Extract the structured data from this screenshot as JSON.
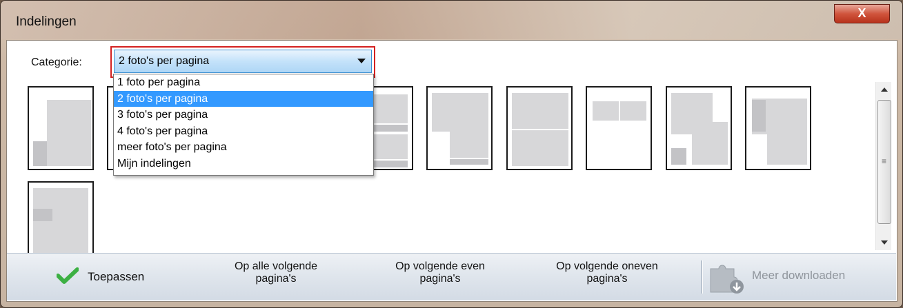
{
  "window": {
    "title": "Indelingen",
    "close_glyph": "X"
  },
  "category": {
    "label": "Categorie:",
    "selected": "2 foto's per pagina",
    "options": [
      "1 foto per pagina",
      "2 foto's per pagina",
      "3 foto's per pagina",
      "4 foto's per pagina",
      "meer foto's per pagina",
      "Mijn indelingen"
    ],
    "highlight_color": "#d32020"
  },
  "actions": {
    "apply": "Toepassen",
    "all_following": [
      "Op alle volgende",
      "pagina's"
    ],
    "even_following": [
      "Op volgende even",
      "pagina's"
    ],
    "odd_following": [
      "Op volgende oneven",
      "pagina's"
    ],
    "more_download": "Meer downloaden"
  },
  "icons": {
    "close": "close-icon",
    "dropdown": "chevron-down-icon",
    "apply": "checkmark-icon",
    "download": "puzzle-download-icon"
  },
  "colors": {
    "selection": "#3399ff",
    "apply_check": "#3cb043"
  }
}
